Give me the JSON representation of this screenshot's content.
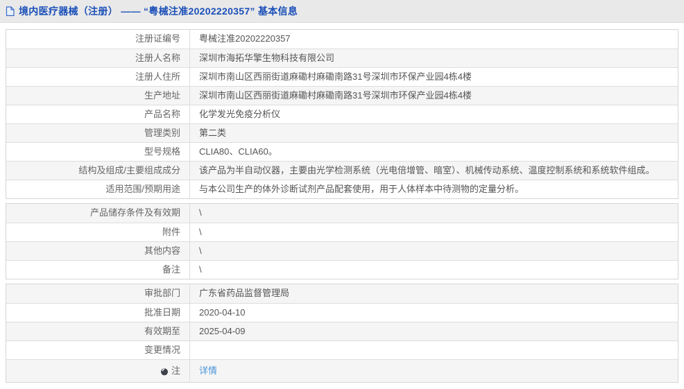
{
  "header": {
    "title": "境内医疗器械（注册） —— “粤械注准20202220357” 基本信息"
  },
  "table": {
    "rows": [
      {
        "label": "注册证编号",
        "value": "粤械注准20202220357"
      },
      {
        "label": "注册人名称",
        "value": "深圳市海拓华擎生物科技有限公司"
      },
      {
        "label": "注册人住所",
        "value": "深圳市南山区西丽街道麻磡村麻磡南路31号深圳市环保产业园4栋4楼"
      },
      {
        "label": "生产地址",
        "value": "深圳市南山区西丽街道麻磡村麻磡南路31号深圳市环保产业园4栋4楼"
      },
      {
        "label": "产品名称",
        "value": "化学发光免疫分析仪"
      },
      {
        "label": "管理类别",
        "value": "第二类"
      },
      {
        "label": "型号规格",
        "value": "CLIA80、CLIA60。"
      },
      {
        "label": "结构及组成/主要组成成分",
        "value": "该产品为半自动仪器，主要由光学检测系统（光电倍增管、暗室）、机械传动系统、温度控制系统和系统软件组成。"
      },
      {
        "label": "适用范围/预期用途",
        "value": "与本公司生产的体外诊断试剂产品配套使用，用于人体样本中待测物的定量分析。"
      },
      {
        "label": "产品储存条件及有效期",
        "value": "\\"
      },
      {
        "label": "附件",
        "value": "\\"
      },
      {
        "label": "其他内容",
        "value": "\\"
      },
      {
        "label": "备注",
        "value": "\\"
      },
      {
        "label": "审批部门",
        "value": "广东省药品监督管理局"
      },
      {
        "label": "批准日期",
        "value": "2020-04-10"
      },
      {
        "label": "有效期至",
        "value": "2025-04-09"
      },
      {
        "label": "变更情况",
        "value": ""
      },
      {
        "label": "注",
        "value": "详情"
      }
    ]
  },
  "icons": {
    "document_icon": "blue outlined page with folded corner",
    "note_icon": "dark filled circle badge before 注 label"
  },
  "colors": {
    "header_bg": "#e9e9e9",
    "title_blue": "#1a4fb8",
    "link_blue": "#4a95db",
    "stripe_gray": "#f5f5f6",
    "border_gray": "#dddddd",
    "label_text": "#666666",
    "value_text": "#555555"
  }
}
